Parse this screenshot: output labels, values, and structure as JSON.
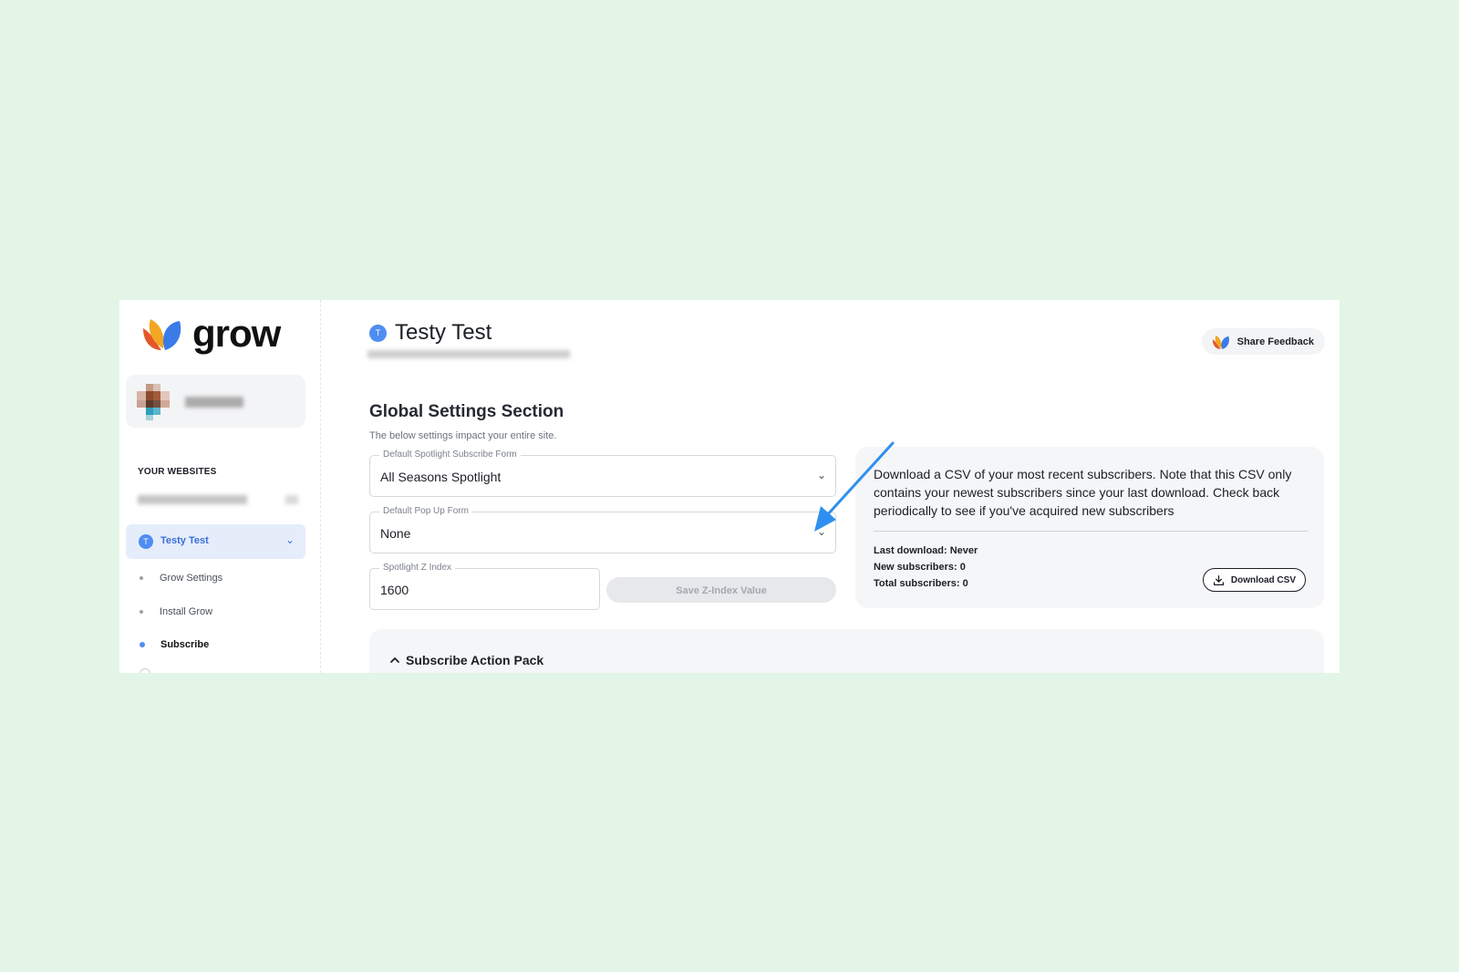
{
  "app": {
    "logo_text": "grow"
  },
  "sidebar": {
    "section_label": "YOUR WEBSITES",
    "active_site": {
      "initial": "T",
      "label": "Testy Test"
    },
    "nav_items": [
      {
        "label": "Grow Settings",
        "active": false
      },
      {
        "label": "Install Grow",
        "active": false
      },
      {
        "label": "Subscribe",
        "active": true
      }
    ]
  },
  "header": {
    "site_initial": "T",
    "title": "Testy Test",
    "feedback_label": "Share Feedback"
  },
  "global_settings": {
    "title": "Global Settings Section",
    "subtitle": "The below settings impact your entire site.",
    "spotlight_form": {
      "label": "Default Spotlight Subscribe Form",
      "value": "All Seasons Spotlight"
    },
    "popup_form": {
      "label": "Default Pop Up Form",
      "value": "None"
    },
    "z_index": {
      "label": "Spotlight Z Index",
      "value": "1600"
    },
    "save_label": "Save Z-Index Value"
  },
  "csv": {
    "description": "Download a CSV of your most recent subscribers. Note that this CSV only contains your newest subscribers since your last download. Check back periodically to see if you've acquired new subscribers",
    "last_download": "Last download: Never",
    "new_subscribers": "New subscribers: 0",
    "total_subscribers": "Total subscribers: 0",
    "download_label": "Download CSV"
  },
  "action_pack": {
    "title": "Subscribe Action Pack"
  },
  "colors": {
    "background": "#e2f5e6",
    "accent": "#4f8df2",
    "annotation_arrow": "#2e8ff0"
  }
}
